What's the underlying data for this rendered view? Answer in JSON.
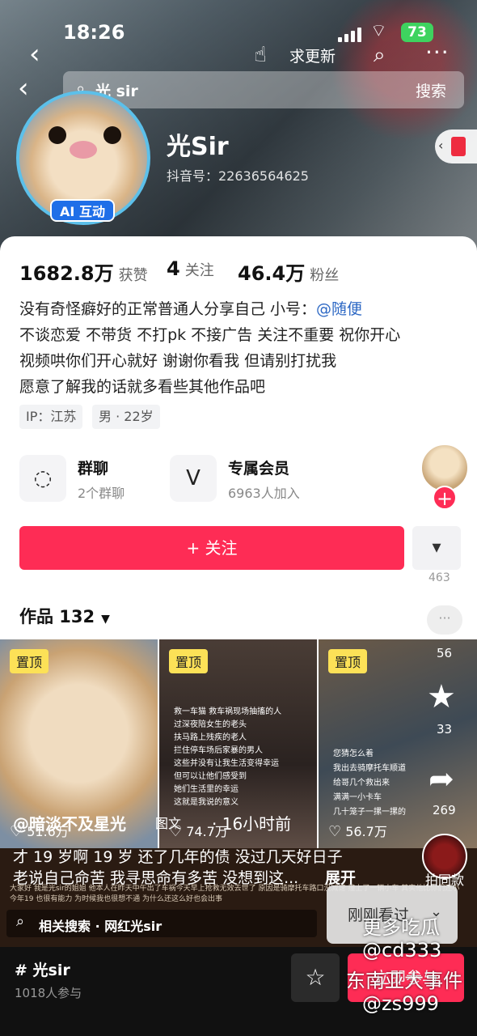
{
  "status": {
    "time": "18:26",
    "battery": "73"
  },
  "topbar": {
    "update_label": "求更新"
  },
  "search": {
    "value": "光 sir",
    "button": "搜索"
  },
  "profile": {
    "ai_badge": "AI 互动",
    "name": "光Sir",
    "douyin_id": "抖音号：22636564625"
  },
  "stats": {
    "likes_value": "1682.8万",
    "likes_label": "获赞",
    "following_value": "4",
    "following_label": "关注",
    "fans_value": "46.4万",
    "fans_label": "粉丝"
  },
  "bio": {
    "line1": "没有奇怪癖好的正常普通人分享自己  小号：",
    "mention": "@随便",
    "line2": "不谈恋爱 不带货 不打pk 不接广告 关注不重要 祝你开心",
    "line3": "视频哄你们开心就好  谢谢你看我 但请别打扰我",
    "line4": "愿意了解我的话就多看些其他作品吧"
  },
  "tags": [
    "IP：江苏",
    "男 · 22岁"
  ],
  "features": [
    {
      "title": "群聊",
      "subtitle": "2个群聊",
      "icon": "chat-icon"
    },
    {
      "title": "专属会员",
      "subtitle": "6963人加入",
      "icon": "vip-icon"
    }
  ],
  "follow_button": "+ 关注",
  "works": {
    "label": "作品 132",
    "caret": "▼"
  },
  "tiles": [
    {
      "pin": "置顶",
      "likes": "51.6万"
    },
    {
      "pin": "置顶",
      "likes": "74.7万",
      "captions": [
        "救一车猫 救车祸现场抽搐的人",
        "过深夜陪女生的老头",
        "扶马路上残疾的老人",
        "拦住停车场后家暴的男人",
        "这些并没有让我生活变得幸运",
        "但可以让他们感受到",
        "她们生活里的幸运",
        "这就是我说的意义"
      ]
    },
    {
      "pin": "置顶",
      "likes": "56.7万",
      "captions": [
        "您猜怎么着",
        "我出去骑摩托车顺道",
        "给哥几个救出来",
        "满满一小卡车",
        "几十笼子一摞一摞的"
      ]
    }
  ],
  "side": {
    "count1": "463",
    "count56": "56",
    "count33": "33",
    "count269": "269",
    "same_label": "拍同款"
  },
  "overlay": {
    "author": "@暗淡不及星光",
    "tag": "图文",
    "time": "· 16小时前",
    "text1": "才 19 岁啊 19 岁 还了几年的债 没过几天好日子",
    "text2": "老说自己命苦 我寻思命有多苦 没想到这...",
    "expand": "展开"
  },
  "lower_text": "大家好 我是光sir的姐姐 他本人在昨天中午出了车祸今天早上抢救无效去世了 原因是骑摩托车路口没减速 撞上了一辆小车 其实他比你们还小今年19 也很有能力 为时候我也很想不通 为什么还这么好也会出事",
  "related": "相关搜索 · 网红光sir",
  "justnow": "刚刚看过",
  "watermark": [
    "更多吃瓜",
    "@cd333",
    "东南亚大事件",
    "@zs999"
  ],
  "bottom": {
    "topic": "光sir",
    "participants": "1018人参与",
    "join": "立即参与"
  }
}
